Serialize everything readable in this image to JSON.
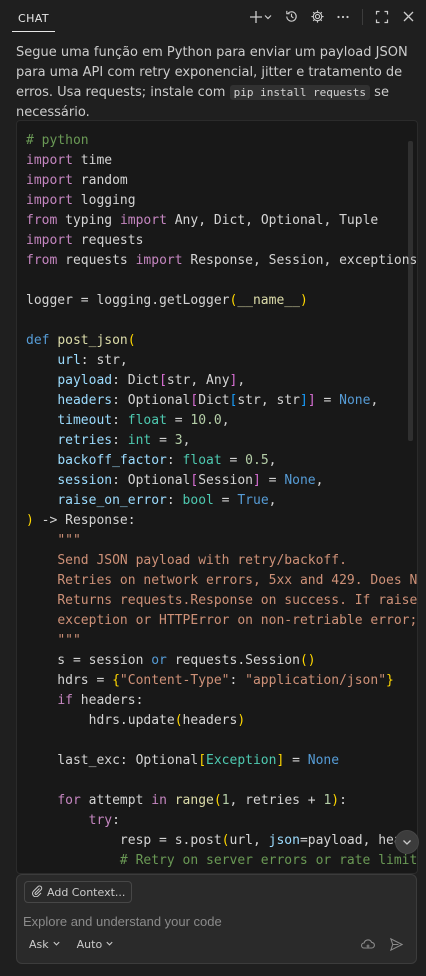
{
  "header": {
    "tab_label": "CHAT",
    "icons": [
      "plus-icon",
      "chevron-down-icon",
      "history-icon",
      "gear-icon",
      "more-icon",
      "maximize-icon",
      "close-icon"
    ]
  },
  "intro": {
    "text_before": "Segue uma função em Python para enviar um payload JSON para uma API com retry exponencial, jitter e tratamento de erros. Usa requests; instale com ",
    "inline_code": "pip install requests",
    "text_after": " se necessário."
  },
  "code": {
    "language": "python",
    "lines": [
      [
        [
          "cm",
          "# python"
        ]
      ],
      [
        [
          "ck",
          "import"
        ],
        [
          "pl",
          " time"
        ]
      ],
      [
        [
          "ck",
          "import"
        ],
        [
          "pl",
          " random"
        ]
      ],
      [
        [
          "ck",
          "import"
        ],
        [
          "pl",
          " logging"
        ]
      ],
      [
        [
          "ck",
          "from"
        ],
        [
          "pl",
          " typing "
        ],
        [
          "ck",
          "import"
        ],
        [
          "pl",
          " Any, Dict, Optional, Tuple"
        ]
      ],
      [
        [
          "ck",
          "import"
        ],
        [
          "pl",
          " requests"
        ]
      ],
      [
        [
          "ck",
          "from"
        ],
        [
          "pl",
          " requests "
        ],
        [
          "ck",
          "import"
        ],
        [
          "pl",
          " Response, Session, exceptions"
        ]
      ],
      [],
      [
        [
          "pl",
          "logger = logging.getLogger"
        ],
        [
          "br",
          "("
        ],
        [
          "fn",
          "__name__"
        ],
        [
          "br",
          ")"
        ]
      ],
      [],
      [
        [
          "kw",
          "def"
        ],
        [
          "pl",
          " "
        ],
        [
          "fn",
          "post_json"
        ],
        [
          "br",
          "("
        ]
      ],
      [
        [
          "pl",
          "    "
        ],
        [
          "var",
          "url"
        ],
        [
          "pl",
          ": str,"
        ]
      ],
      [
        [
          "pl",
          "    "
        ],
        [
          "var",
          "payload"
        ],
        [
          "pl",
          ": Dict"
        ],
        [
          "bp",
          "["
        ],
        [
          "pl",
          "str, Any"
        ],
        [
          "bp",
          "]"
        ],
        [
          "pl",
          ","
        ]
      ],
      [
        [
          "pl",
          "    "
        ],
        [
          "var",
          "headers"
        ],
        [
          "pl",
          ": Optional"
        ],
        [
          "bp",
          "["
        ],
        [
          "pl",
          "Dict"
        ],
        [
          "bb",
          "["
        ],
        [
          "pl",
          "str, str"
        ],
        [
          "bb",
          "]"
        ],
        [
          "bp",
          "]"
        ],
        [
          "pl",
          " = "
        ],
        [
          "kw",
          "None"
        ],
        [
          "pl",
          ","
        ]
      ],
      [
        [
          "pl",
          "    "
        ],
        [
          "var",
          "timeout"
        ],
        [
          "pl",
          ": "
        ],
        [
          "ty",
          "float"
        ],
        [
          "pl",
          " = "
        ],
        [
          "nu",
          "10.0"
        ],
        [
          "pl",
          ","
        ]
      ],
      [
        [
          "pl",
          "    "
        ],
        [
          "var",
          "retries"
        ],
        [
          "pl",
          ": "
        ],
        [
          "ty",
          "int"
        ],
        [
          "pl",
          " = "
        ],
        [
          "nu",
          "3"
        ],
        [
          "pl",
          ","
        ]
      ],
      [
        [
          "pl",
          "    "
        ],
        [
          "var",
          "backoff_factor"
        ],
        [
          "pl",
          ": "
        ],
        [
          "ty",
          "float"
        ],
        [
          "pl",
          " = "
        ],
        [
          "nu",
          "0.5"
        ],
        [
          "pl",
          ","
        ]
      ],
      [
        [
          "pl",
          "    "
        ],
        [
          "var",
          "session"
        ],
        [
          "pl",
          ": Optional"
        ],
        [
          "bp",
          "["
        ],
        [
          "pl",
          "Session"
        ],
        [
          "bp",
          "]"
        ],
        [
          "pl",
          " = "
        ],
        [
          "kw",
          "None"
        ],
        [
          "pl",
          ","
        ]
      ],
      [
        [
          "pl",
          "    "
        ],
        [
          "var",
          "raise_on_error"
        ],
        [
          "pl",
          ": "
        ],
        [
          "ty",
          "bool"
        ],
        [
          "pl",
          " = "
        ],
        [
          "kw",
          "True"
        ],
        [
          "pl",
          ","
        ]
      ],
      [
        [
          "br",
          ")"
        ],
        [
          "pl",
          " -> Response:"
        ]
      ],
      [
        [
          "pl",
          "    "
        ],
        [
          "st",
          "\"\"\""
        ]
      ],
      [
        [
          "pl",
          "    "
        ],
        [
          "st",
          "Send JSON payload with retry/backoff."
        ]
      ],
      [
        [
          "pl",
          "    "
        ],
        [
          "st",
          "Retries on network errors, 5xx and 429. Does N"
        ]
      ],
      [
        [
          "pl",
          "    "
        ],
        [
          "st",
          "Returns requests.Response on success. If raise_"
        ]
      ],
      [
        [
          "pl",
          "    "
        ],
        [
          "st",
          "exception or HTTPError on non-retriable error;"
        ]
      ],
      [
        [
          "pl",
          "    "
        ],
        [
          "st",
          "\"\"\""
        ]
      ],
      [
        [
          "pl",
          "    s = session "
        ],
        [
          "kw",
          "or"
        ],
        [
          "pl",
          " requests.Session"
        ],
        [
          "br",
          "()"
        ]
      ],
      [
        [
          "pl",
          "    hdrs = "
        ],
        [
          "br",
          "{"
        ],
        [
          "st",
          "\"Content-Type\""
        ],
        [
          "pl",
          ": "
        ],
        [
          "st",
          "\"application/json\""
        ],
        [
          "br",
          "}"
        ]
      ],
      [
        [
          "pl",
          "    "
        ],
        [
          "ck",
          "if"
        ],
        [
          "pl",
          " headers:"
        ]
      ],
      [
        [
          "pl",
          "        hdrs.update"
        ],
        [
          "br",
          "("
        ],
        [
          "pl",
          "headers"
        ],
        [
          "br",
          ")"
        ]
      ],
      [],
      [
        [
          "pl",
          "    last_exc: Optional"
        ],
        [
          "br",
          "["
        ],
        [
          "ty",
          "Exception"
        ],
        [
          "br",
          "]"
        ],
        [
          "pl",
          " = "
        ],
        [
          "kw",
          "None"
        ]
      ],
      [],
      [
        [
          "pl",
          "    "
        ],
        [
          "ck",
          "for"
        ],
        [
          "pl",
          " attempt "
        ],
        [
          "ck",
          "in"
        ],
        [
          "pl",
          " "
        ],
        [
          "fn",
          "range"
        ],
        [
          "br",
          "("
        ],
        [
          "nu",
          "1"
        ],
        [
          "pl",
          ", retries + "
        ],
        [
          "nu",
          "1"
        ],
        [
          "br",
          ")"
        ],
        [
          "pl",
          ":"
        ]
      ],
      [
        [
          "pl",
          "        "
        ],
        [
          "ck",
          "try"
        ],
        [
          "pl",
          ":"
        ]
      ],
      [
        [
          "pl",
          "            resp = s.post"
        ],
        [
          "br",
          "("
        ],
        [
          "pl",
          "url, "
        ],
        [
          "var",
          "json"
        ],
        [
          "pl",
          "=payload, hea"
        ]
      ],
      [
        [
          "pl",
          "            "
        ],
        [
          "cm",
          "# Retry on server errors or rate limit"
        ]
      ]
    ]
  },
  "input": {
    "add_context_label": "Add Context...",
    "placeholder": "Explore and understand your code",
    "value": "",
    "mode_label": "Ask",
    "model_label": "Auto"
  },
  "colors": {
    "background": "#1f1f1f",
    "code_background": "#181818",
    "keyword": "#569cd6",
    "control": "#c586c0",
    "string": "#ce9178",
    "comment": "#6a9955",
    "number": "#b5cea8",
    "type": "#4ec9b0",
    "function": "#dcdcaa",
    "variable": "#9cdcfe"
  }
}
